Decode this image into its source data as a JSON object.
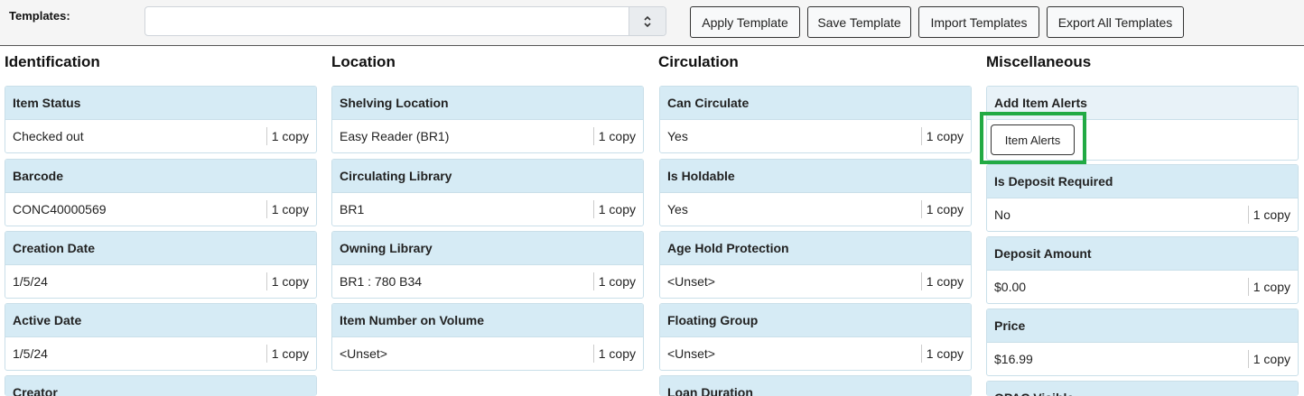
{
  "toolbar": {
    "templates_label": "Templates:",
    "select_value": "",
    "apply_label": "Apply Template",
    "save_label": "Save Template",
    "import_label": "Import Templates",
    "export_label": "Export All Templates"
  },
  "columns": {
    "identification": "Identification",
    "location": "Location",
    "circulation": "Circulation",
    "misc": "Miscellaneous"
  },
  "cards": {
    "item_status": {
      "label": "Item Status",
      "value": "Checked out",
      "count": "1 copy"
    },
    "barcode": {
      "label": "Barcode",
      "value": "CONC40000569",
      "count": "1 copy"
    },
    "creation_date": {
      "label": "Creation Date",
      "value": "1/5/24",
      "count": "1 copy"
    },
    "active_date": {
      "label": "Active Date",
      "value": "1/5/24",
      "count": "1 copy"
    },
    "creator": {
      "label": "Creator"
    },
    "shelving_location": {
      "label": "Shelving Location",
      "value": "Easy Reader (BR1)",
      "count": "1 copy"
    },
    "circ_library": {
      "label": "Circulating Library",
      "value": "BR1",
      "count": "1 copy"
    },
    "owning_library": {
      "label": "Owning Library",
      "value": "BR1 : 780 B34",
      "count": "1 copy"
    },
    "item_number": {
      "label": "Item Number on Volume",
      "value": "<Unset>",
      "count": "1 copy"
    },
    "can_circulate": {
      "label": "Can Circulate",
      "value": "Yes",
      "count": "1 copy"
    },
    "is_holdable": {
      "label": "Is Holdable",
      "value": "Yes",
      "count": "1 copy"
    },
    "age_hold": {
      "label": "Age Hold Protection",
      "value": "<Unset>",
      "count": "1 copy"
    },
    "floating_group": {
      "label": "Floating Group",
      "value": "<Unset>",
      "count": "1 copy"
    },
    "loan_duration": {
      "label": "Loan Duration"
    },
    "add_item_alerts": {
      "label": "Add Item Alerts",
      "button": "Item Alerts"
    },
    "deposit_required": {
      "label": "Is Deposit Required",
      "value": "No",
      "count": "1 copy"
    },
    "deposit_amount": {
      "label": "Deposit Amount",
      "value": "$0.00",
      "count": "1 copy"
    },
    "price": {
      "label": "Price",
      "value": "$16.99",
      "count": "1 copy"
    },
    "opac_visible": {
      "label": "OPAC Visible"
    }
  },
  "colors": {
    "highlight": "#22aa44",
    "card_header": "#d6ebf5"
  }
}
